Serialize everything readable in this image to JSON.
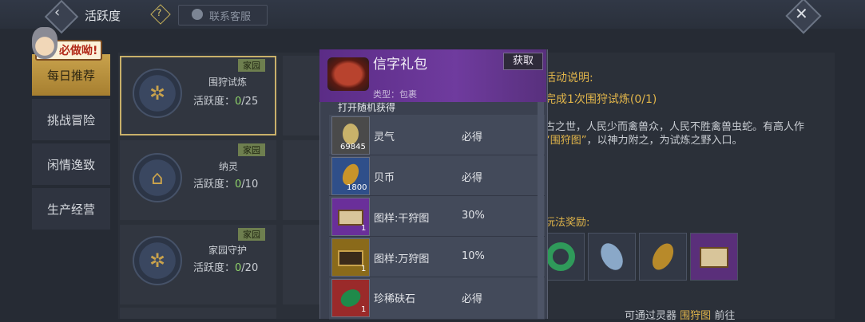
{
  "header": {
    "title": "活跃度",
    "help_symbol": "?",
    "contact_label": "联系客服",
    "close_symbol": "✕",
    "back_symbol": "‹"
  },
  "badge": {
    "text": "必做呦!"
  },
  "nav": {
    "items": [
      {
        "label": "每日推荐",
        "active": true
      },
      {
        "label": "挑战冒险",
        "active": false
      },
      {
        "label": "闲情逸致",
        "active": false
      },
      {
        "label": "生产经营",
        "active": false
      }
    ]
  },
  "cards": [
    {
      "tag": "家园",
      "name": "围狩试炼",
      "activity_label": "活跃度：",
      "current": "0",
      "total": "/25"
    },
    {
      "tag": "家园",
      "name": "纳灵",
      "activity_label": "活跃度：",
      "current": "0",
      "total": "/10"
    },
    {
      "tag": "家园",
      "name": "家园守护",
      "activity_label": "活跃度：",
      "current": "0",
      "total": "/20"
    }
  ],
  "info": {
    "section_title": "活动说明:",
    "task": "完成1次围狩试炼(0/1)",
    "desc_line1": "古之世，人民少而禽兽众，人民不胜禽兽虫蛇。有高人作",
    "desc_line2_highlight": "“围狩图”",
    "desc_line2_rest": "，以神力附之，为试炼之野入口。",
    "reward_title": "玩法奖励:",
    "footer_prefix": "可通过灵器",
    "footer_link": "围狩图",
    "footer_suffix": "前往"
  },
  "popup": {
    "title": "信字礼包",
    "type_label": "类型：包裹",
    "get_label": "获取",
    "subtitle": "打开随机获得",
    "rows": [
      {
        "name": "灵气",
        "prob": "必得",
        "count": "69845",
        "color": "#4a4a4a"
      },
      {
        "name": "贝币",
        "prob": "必得",
        "count": "1800",
        "color": "#2f4f8a"
      },
      {
        "name": "图样:干狩图",
        "prob": "30%",
        "count": "1",
        "color": "#6a2f9a"
      },
      {
        "name": "图样:万狩图",
        "prob": "10%",
        "count": "1",
        "color": "#8a6a1a"
      },
      {
        "name": "珍稀砆石",
        "prob": "必得",
        "count": "1",
        "color": "#9a2a2a"
      }
    ]
  }
}
